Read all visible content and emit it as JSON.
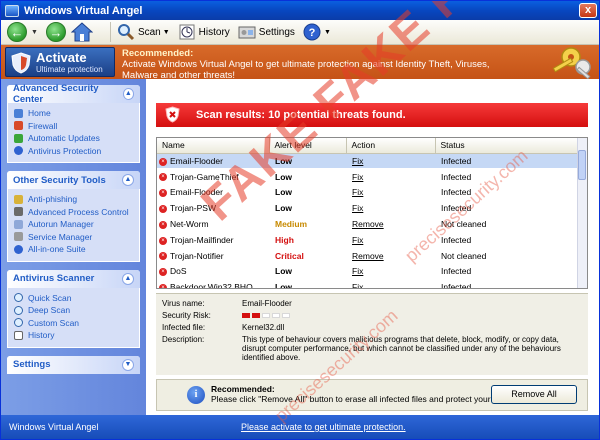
{
  "window": {
    "title": "Windows Virtual Angel",
    "close_label": "x"
  },
  "toolbar": {
    "back_label": "←",
    "forward_label": "→",
    "scan_label": "Scan",
    "history_label": "History",
    "settings_label": "Settings"
  },
  "banner": {
    "activate_title": "Activate",
    "activate_sub": "Ultimate protection",
    "rec_title": "Recommended:",
    "rec_text": "Activate Windows Virtual Angel to get ultimate protection against Identity Theft, Viruses, Malware and other threats!"
  },
  "sidebar": {
    "panels": [
      {
        "title": "Advanced Security Center",
        "items": [
          "Home",
          "Firewall",
          "Automatic Updates",
          "Antivirus Protection"
        ]
      },
      {
        "title": "Other Security Tools",
        "items": [
          "Anti-phishing",
          "Advanced Process Control",
          "Autorun Manager",
          "Service Manager",
          "All-in-one Suite"
        ]
      },
      {
        "title": "Antivirus Scanner",
        "items": [
          "Quick Scan",
          "Deep Scan",
          "Custom Scan",
          "History"
        ]
      },
      {
        "title": "Settings",
        "items": []
      }
    ]
  },
  "scan": {
    "header": "Scan results: 10 potential threats found."
  },
  "table": {
    "columns": [
      "Name",
      "Alert level",
      "Action",
      "Status"
    ],
    "rows": [
      {
        "name": "Email-Flooder",
        "level": "Low",
        "level_color": "#000000",
        "action": "Fix",
        "status": "Infected"
      },
      {
        "name": "Trojan-GameThief",
        "level": "Low",
        "level_color": "#000000",
        "action": "Fix",
        "status": "Infected"
      },
      {
        "name": "Email-Flooder",
        "level": "Low",
        "level_color": "#000000",
        "action": "Fix",
        "status": "Infected"
      },
      {
        "name": "Trojan-PSW",
        "level": "Low",
        "level_color": "#000000",
        "action": "Fix",
        "status": "Infected"
      },
      {
        "name": "Net-Worm",
        "level": "Medium",
        "level_color": "#c78a00",
        "action": "Remove",
        "status": "Not cleaned"
      },
      {
        "name": "Trojan-Mailfinder",
        "level": "High",
        "level_color": "#d40f0f",
        "action": "Fix",
        "status": "Infected"
      },
      {
        "name": "Trojan-Notifier",
        "level": "Critical",
        "level_color": "#d40f0f",
        "action": "Remove",
        "status": "Not cleaned"
      },
      {
        "name": "DoS",
        "level": "Low",
        "level_color": "#000000",
        "action": "Fix",
        "status": "Infected"
      },
      {
        "name": "Backdoor.Win32.BHO",
        "level": "Low",
        "level_color": "#000000",
        "action": "Fix",
        "status": "Infected"
      }
    ]
  },
  "details": {
    "virus_label": "Virus name:",
    "virus_value": "Email-Flooder",
    "risk_label": "Security Risk:",
    "risk_level": 0.4,
    "file_label": "Infected file:",
    "file_value": "Kernel32.dll",
    "desc_label": "Description:",
    "desc_value": "This type of behaviour covers malicious programs that delete, block, modify, or copy data, disrupt computer performance, but which cannot be classified under any of the behaviours identified above."
  },
  "recommend": {
    "title": "Recommended:",
    "text": "Please click \"Remove All\" button to erase all infected files and protect your PC",
    "button": "Remove All"
  },
  "status": {
    "app_name": "Windows Virtual Angel",
    "link": "Please activate to get ultimate protection."
  },
  "watermark": {
    "fake": "FAKE FAKE FAKE",
    "site1": "precisesecurity.com",
    "site2": "precisesecurity.com"
  }
}
